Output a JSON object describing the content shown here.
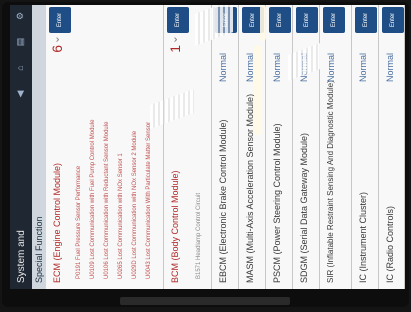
{
  "app": {
    "title": "System and"
  },
  "header": {
    "section": "Special Function"
  },
  "modules": [
    {
      "name": "ECM (Engine Control Module)",
      "count": "6",
      "enter": "Enter"
    },
    {
      "name": "BCM (Body Control Module)",
      "count": "1",
      "enter": "Enter"
    },
    {
      "name": "EBCM (Electronic Brake Control Module)",
      "status": "Normal",
      "enter": "Enter"
    },
    {
      "name": "MASM (Multi-Axis Acceleration Sensor Module)",
      "status": "Normal",
      "enter": "Enter"
    },
    {
      "name": "PSCM (Power Steering Control Module)",
      "status": "Normal",
      "enter": "Enter"
    },
    {
      "name": "SDGM (Serial Data Gateway Module)",
      "status": "Normal",
      "enter": "Enter"
    },
    {
      "name": "SIR (Inflatable Restraint Sensing And Diagnostic Module)",
      "status": "Normal",
      "enter": "Enter"
    },
    {
      "name": "IC (Instrument Cluster)",
      "status": "Normal",
      "enter": "Enter"
    },
    {
      "name": "IC (Radio Controls)",
      "status": "Normal",
      "enter": "Enter"
    }
  ],
  "ecm_dtcs": [
    "P0191 Fuel Pressure Sensor Performance",
    "U0109 Lost Communication with Fuel Pump Control Module",
    "U0106 Lost Communication with Reductant Sensor Module",
    "U0265 Lost Communication with NOx Sensor 1",
    "U029D Lost Communication with NOx Sensor 2 Module",
    "U0043 Lost Communication With Particulate Matter Sensor"
  ],
  "bcm_dtcs": [
    "B1571 Headlamp Control Circuit"
  ],
  "colors": {
    "fault": "#b02828",
    "normal": "#4a6fa0",
    "enter_button": "#1f4e86",
    "header": "#1f2733"
  },
  "icons": [
    "back-icon",
    "home-icon",
    "menu-icon",
    "settings-icon"
  ]
}
